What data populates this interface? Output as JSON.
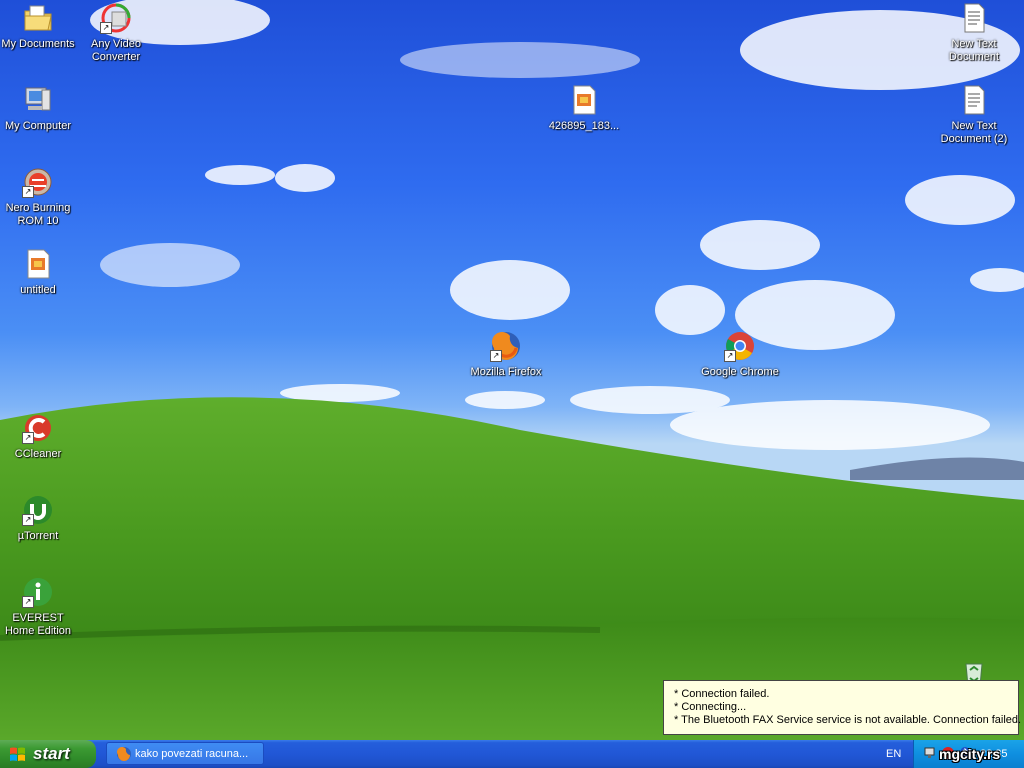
{
  "desktop": {
    "icons": [
      {
        "label": "My Documents",
        "icon": "folder-documents-icon"
      },
      {
        "label": "Any Video Converter",
        "icon": "video-converter-icon"
      },
      {
        "label": "My Computer",
        "icon": "computer-icon"
      },
      {
        "label": "Nero Burning ROM 10",
        "icon": "nero-icon"
      },
      {
        "label": "untitled",
        "icon": "image-file-icon"
      },
      {
        "label": "CCleaner",
        "icon": "ccleaner-icon"
      },
      {
        "label": "µTorrent",
        "icon": "utorrent-icon"
      },
      {
        "label": "EVEREST Home Edition",
        "icon": "everest-icon"
      },
      {
        "label": "426895_183...",
        "icon": "image-file-icon"
      },
      {
        "label": "Mozilla Firefox",
        "icon": "firefox-icon"
      },
      {
        "label": "Google Chrome",
        "icon": "chrome-icon"
      },
      {
        "label": "New Text Document",
        "icon": "text-document-icon"
      },
      {
        "label": "New Text Document (2)",
        "icon": "text-document-icon"
      },
      {
        "label": "",
        "icon": "recycle-bin-icon"
      }
    ]
  },
  "notification": {
    "lines": [
      "* Connection failed.",
      "* Connecting...",
      "* The Bluetooth FAX Service service is not available. Connection failed."
    ]
  },
  "taskbar": {
    "start_label": "start",
    "task_item_label": "kako povezati racuna...",
    "language": "EN",
    "clock": "22:35",
    "watermark": "mgcity.rs"
  },
  "colors": {
    "taskbar_blue": "#245edb",
    "start_green": "#3c9a33",
    "tray_blue": "#0f8fe0",
    "balloon_bg": "#ffffe1"
  }
}
